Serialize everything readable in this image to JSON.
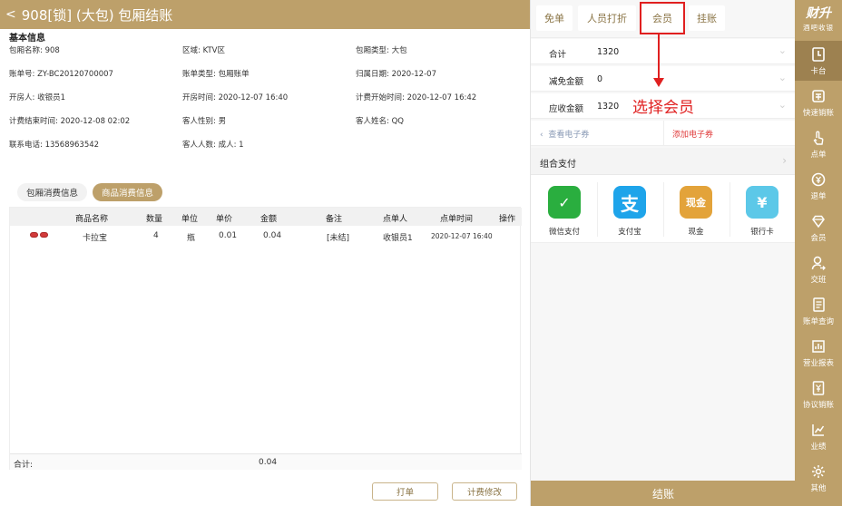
{
  "header": {
    "back_glyph": "<",
    "title": "908[锁] (大包) 包厢结账"
  },
  "basic_info": {
    "title": "基本信息",
    "rows": [
      [
        {
          "label": "包厢名称:",
          "value": "908"
        },
        {
          "label": "区域:",
          "value": "KTV区"
        },
        {
          "label": "包厢类型:",
          "value": "大包"
        }
      ],
      [
        {
          "label": "账单号:",
          "value": "ZY-BC20120700007"
        },
        {
          "label": "账单类型:",
          "value": "包厢账单"
        },
        {
          "label": "归属日期:",
          "value": "2020-12-07"
        }
      ],
      [
        {
          "label": "开房人:",
          "value": "收银员1"
        },
        {
          "label": "开房时间:",
          "value": "2020-12-07 16:40"
        },
        {
          "label": "计费开始时间:",
          "value": "2020-12-07 16:42"
        }
      ],
      [
        {
          "label": "计费结束时间:",
          "value": "2020-12-08 02:02"
        },
        {
          "label": "客人性别:",
          "value": "男"
        },
        {
          "label": "客人姓名:",
          "value": "QQ"
        }
      ],
      [
        {
          "label": "联系电话:",
          "value": "13568963542"
        },
        {
          "label": "客人人数:",
          "value": "成人: 1"
        }
      ]
    ]
  },
  "consume_tabs": [
    {
      "label": "包厢消费信息",
      "active": false
    },
    {
      "label": "商品消费信息",
      "active": true
    }
  ],
  "table": {
    "columns": [
      "商品名称",
      "数量",
      "单位",
      "单价",
      "金额",
      "备注",
      "点单人",
      "点单时间",
      "操作"
    ],
    "rows": [
      {
        "name": "卡拉宝",
        "qty": "4",
        "unit": "瓶",
        "price": "0.01",
        "amount": "0.04",
        "note": "[未结]",
        "orderer": "收银员1",
        "time": "2020-12-07 16:40",
        "badge_color": "#d23b3b"
      }
    ],
    "total_label": "合计:",
    "total_value": "0.04"
  },
  "bottom_buttons": {
    "print": "打单",
    "modify": "计费修改"
  },
  "checkout_tabs": [
    "免单",
    "人员打折",
    "会员",
    "挂账"
  ],
  "amounts": [
    {
      "label": "合计",
      "value": "1320"
    },
    {
      "label": "减免金额",
      "value": "0"
    },
    {
      "label": "应收金额",
      "value": "1320"
    }
  ],
  "annotation": "选择会员",
  "voucher": {
    "view": "查看电子券",
    "add": "添加电子券"
  },
  "combo_pay": "组合支付",
  "payments": [
    {
      "label": "微信支付",
      "icon": "wechat-pay-icon",
      "color": "#2aae3f",
      "glyph": "✓"
    },
    {
      "label": "支付宝",
      "icon": "alipay-icon",
      "color": "#1ea4ea",
      "glyph": "支"
    },
    {
      "label": "现金",
      "icon": "cash-icon",
      "color": "#e3a33a",
      "glyph": "现金"
    },
    {
      "label": "银行卡",
      "icon": "bank-card-icon",
      "color": "#5cc8e8",
      "glyph": "¥"
    }
  ],
  "checkout_button": "结账",
  "brand": {
    "name": "财升",
    "sub": "酒吧收银"
  },
  "sidebar": [
    {
      "label": "卡台",
      "icon": "card-table-icon",
      "active": true
    },
    {
      "label": "快速销账",
      "icon": "quick-clear-icon",
      "active": false
    },
    {
      "label": "点单",
      "icon": "order-icon",
      "active": false
    },
    {
      "label": "退单",
      "icon": "return-icon",
      "active": false
    },
    {
      "label": "会员",
      "icon": "member-icon",
      "active": false
    },
    {
      "label": "交班",
      "icon": "shift-icon",
      "active": false
    },
    {
      "label": "账单查询",
      "icon": "bill-query-icon",
      "active": false
    },
    {
      "label": "营业报表",
      "icon": "report-icon",
      "active": false
    },
    {
      "label": "协议销账",
      "icon": "agreement-icon",
      "active": false
    },
    {
      "label": "业绩",
      "icon": "performance-icon",
      "active": false
    },
    {
      "label": "其他",
      "icon": "settings-icon",
      "active": false
    }
  ],
  "colors": {
    "gold": "#bda06a",
    "gold_dark": "#9d8150",
    "red": "#e02020"
  }
}
